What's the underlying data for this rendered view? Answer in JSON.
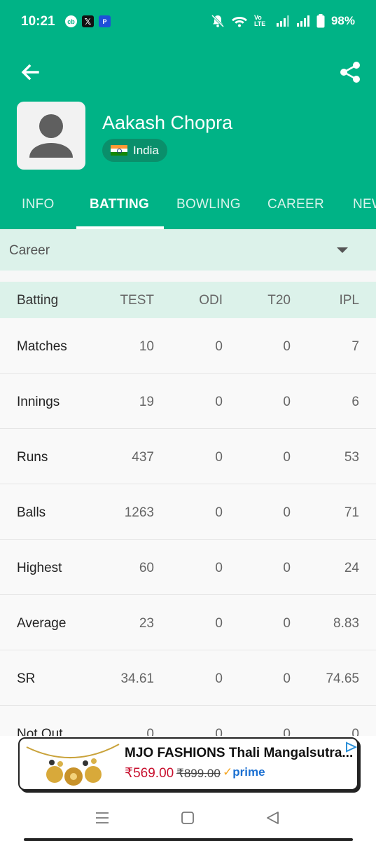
{
  "status_bar": {
    "time": "10:21",
    "notification_icons": [
      "cb",
      "𝕏",
      "P"
    ],
    "network_label": "Vo LTE",
    "battery": "98%"
  },
  "player": {
    "name": "Aakash Chopra",
    "country": "India"
  },
  "tabs": [
    "INFO",
    "BATTING",
    "BOWLING",
    "CAREER",
    "NEWS"
  ],
  "active_tab": "BATTING",
  "filter": {
    "label": "Career"
  },
  "table": {
    "headers": [
      "Batting",
      "TEST",
      "ODI",
      "T20",
      "IPL"
    ],
    "rows": [
      [
        "Matches",
        "10",
        "0",
        "0",
        "7"
      ],
      [
        "Innings",
        "19",
        "0",
        "0",
        "6"
      ],
      [
        "Runs",
        "437",
        "0",
        "0",
        "53"
      ],
      [
        "Balls",
        "1263",
        "0",
        "0",
        "71"
      ],
      [
        "Highest",
        "60",
        "0",
        "0",
        "24"
      ],
      [
        "Average",
        "23",
        "0",
        "0",
        "8.83"
      ],
      [
        "SR",
        "34.61",
        "0",
        "0",
        "74.65"
      ],
      [
        "Not Out",
        "0",
        "0",
        "0",
        "0"
      ]
    ]
  },
  "ad": {
    "title": "MJO FASHIONS Thali Mangalsutra...",
    "price": "₹569.00",
    "old_price": "₹899.00",
    "prime_label": "prime",
    "prime_check": "✓"
  },
  "colors": {
    "header": "#00b386",
    "filter_band": "#dcf2ea",
    "country_chip": "#0a8f6b"
  }
}
